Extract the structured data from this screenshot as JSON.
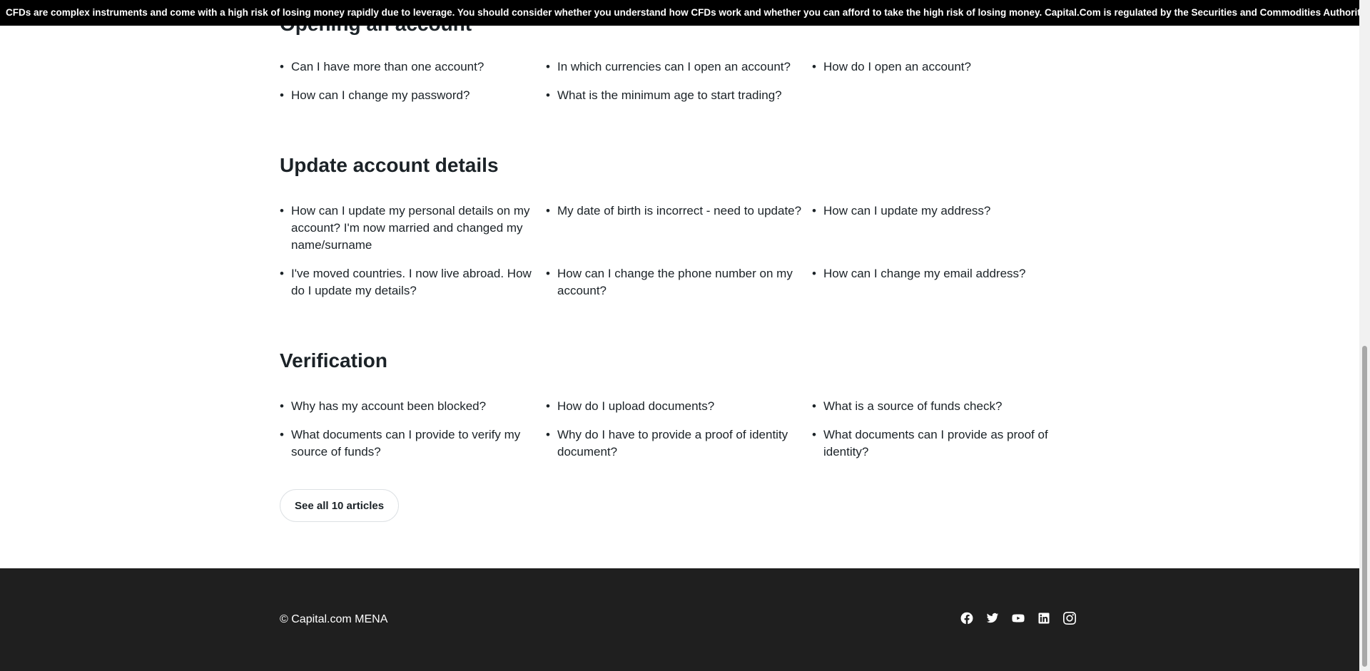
{
  "risk_warning": "CFDs are complex instruments and come with a high risk of losing money rapidly due to leverage. You should consider whether you understand how CFDs work and whether you can afford to take the high risk of losing money. Capital.Com is regulated by the Securities and Commodities Authority.",
  "sections": [
    {
      "title": "Opening an account",
      "articles": [
        "Can I have more than one account?",
        "In which currencies can I open an account?",
        "How do I open an account?",
        "How can I change my password?",
        "What is the minimum age to start trading?"
      ]
    },
    {
      "title": "Update account details",
      "articles": [
        "How can I update my personal details on my account? I'm now married and changed my name/surname",
        "My date of birth is incorrect - need to update?",
        "How can I update my address?",
        "I've moved countries. I now live abroad. How do I update my details?",
        "How can I change the phone number on my account?",
        "How can I change my email address?"
      ]
    },
    {
      "title": "Verification",
      "articles": [
        "Why has my account been blocked?",
        "How do I upload documents?",
        "What is a source of funds check?",
        "What documents can I provide to verify my source of funds?",
        "Why do I have to provide a proof of identity document?",
        "What documents can I provide as proof of identity?"
      ],
      "see_all_label": "See all 10 articles"
    }
  ],
  "footer": {
    "copyright": "© Capital.com MENA",
    "socials": [
      "facebook-icon",
      "twitter-icon",
      "youtube-icon",
      "linkedin-icon",
      "instagram-icon"
    ]
  },
  "colors": {
    "text": "#1b2227",
    "risk_bar_bg": "#000000",
    "footer_bg": "#1f1f1f"
  }
}
